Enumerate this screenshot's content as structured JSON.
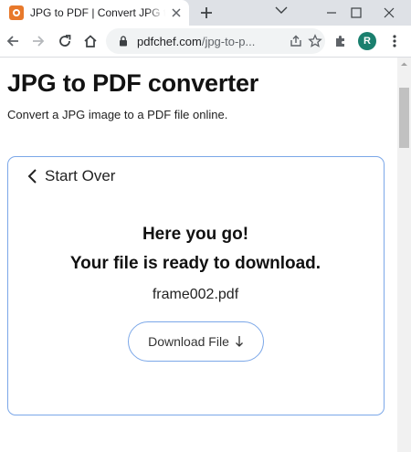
{
  "browser": {
    "tab": {
      "title": "JPG to PDF | Convert JPG to PDF"
    },
    "address": {
      "host": "pdfchef.com",
      "path": "/jpg-to-p..."
    },
    "profile_initial": "R"
  },
  "page": {
    "heading": "JPG to PDF converter",
    "subtitle": "Convert a JPG image to a PDF file online.",
    "result_card": {
      "back_label": "Start Over",
      "headline_1": "Here you go!",
      "headline_2": "Your file is ready to download.",
      "filename": "frame002.pdf",
      "download_label": "Download File",
      "accent_color": "#7ba7e8"
    }
  }
}
